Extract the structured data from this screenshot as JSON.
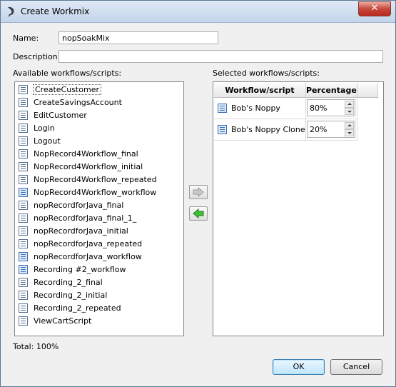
{
  "window": {
    "title": "Create Workmix",
    "close_label": "✕"
  },
  "form": {
    "name_label": "Name:",
    "name_value": "nopSoakMix",
    "description_label": "Description:",
    "description_value": ""
  },
  "available": {
    "label": "Available workflows/scripts:",
    "items": [
      {
        "label": "CreateCustomer",
        "icon": "script-icon"
      },
      {
        "label": "CreateSavingsAccount",
        "icon": "script-icon"
      },
      {
        "label": "EditCustomer",
        "icon": "script-icon"
      },
      {
        "label": "Login",
        "icon": "script-icon"
      },
      {
        "label": "Logout",
        "icon": "script-icon"
      },
      {
        "label": "NopRecord4Workflow_final",
        "icon": "script-icon"
      },
      {
        "label": "NopRecord4Workflow_initial",
        "icon": "script-icon"
      },
      {
        "label": "NopRecord4Workflow_repeated",
        "icon": "script-icon"
      },
      {
        "label": "NopRecord4Workflow_workflow",
        "icon": "workflow-icon"
      },
      {
        "label": "nopRecordforJava_final",
        "icon": "script-icon"
      },
      {
        "label": "nopRecordforJava_final_1_",
        "icon": "script-icon"
      },
      {
        "label": "nopRecordforJava_initial",
        "icon": "script-icon"
      },
      {
        "label": "nopRecordforJava_repeated",
        "icon": "script-icon"
      },
      {
        "label": "nopRecordforJava_workflow",
        "icon": "workflow-icon"
      },
      {
        "label": "Recording #2_workflow",
        "icon": "workflow-icon"
      },
      {
        "label": "Recording_2_final",
        "icon": "script-icon"
      },
      {
        "label": "Recording_2_initial",
        "icon": "script-icon"
      },
      {
        "label": "Recording_2_repeated",
        "icon": "script-icon"
      },
      {
        "label": "ViewCartScript",
        "icon": "script-icon"
      }
    ]
  },
  "selected": {
    "label": "Selected workflows/scripts:",
    "columns": [
      "Workflow/script",
      "Percentage"
    ],
    "rows": [
      {
        "name": "Bob's Noppy",
        "percentage": "80%"
      },
      {
        "name": "Bob's Noppy Clone",
        "percentage": "20%"
      }
    ]
  },
  "total_label": "Total: 100%",
  "buttons": {
    "ok": "OK",
    "cancel": "Cancel"
  },
  "colors": {
    "add_arrow": "#a8a8a8",
    "remove_arrow": "#2fa82a"
  }
}
